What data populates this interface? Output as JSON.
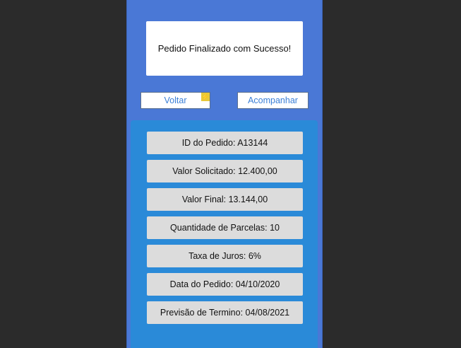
{
  "message": "Pedido Finalizado com Sucesso!",
  "buttons": {
    "back_label": "Voltar",
    "track_label": "Acompanhar",
    "back_badge_icon": "lightning-icon"
  },
  "details": [
    "ID do Pedido: A13144",
    "Valor Solicitado: 12.400,00",
    "Valor Final: 13.144,00",
    "Quantidade de Parcelas: 10",
    "Taxa de Juros: 6%",
    "Data do Pedido: 04/10/2020",
    "Previsão de Termino: 04/08/2021"
  ],
  "colors": {
    "phone_background": "#4a78d6",
    "panel_background": "#2a8ad8",
    "row_background": "#dcdcdc",
    "button_text": "#3a7fd6"
  }
}
